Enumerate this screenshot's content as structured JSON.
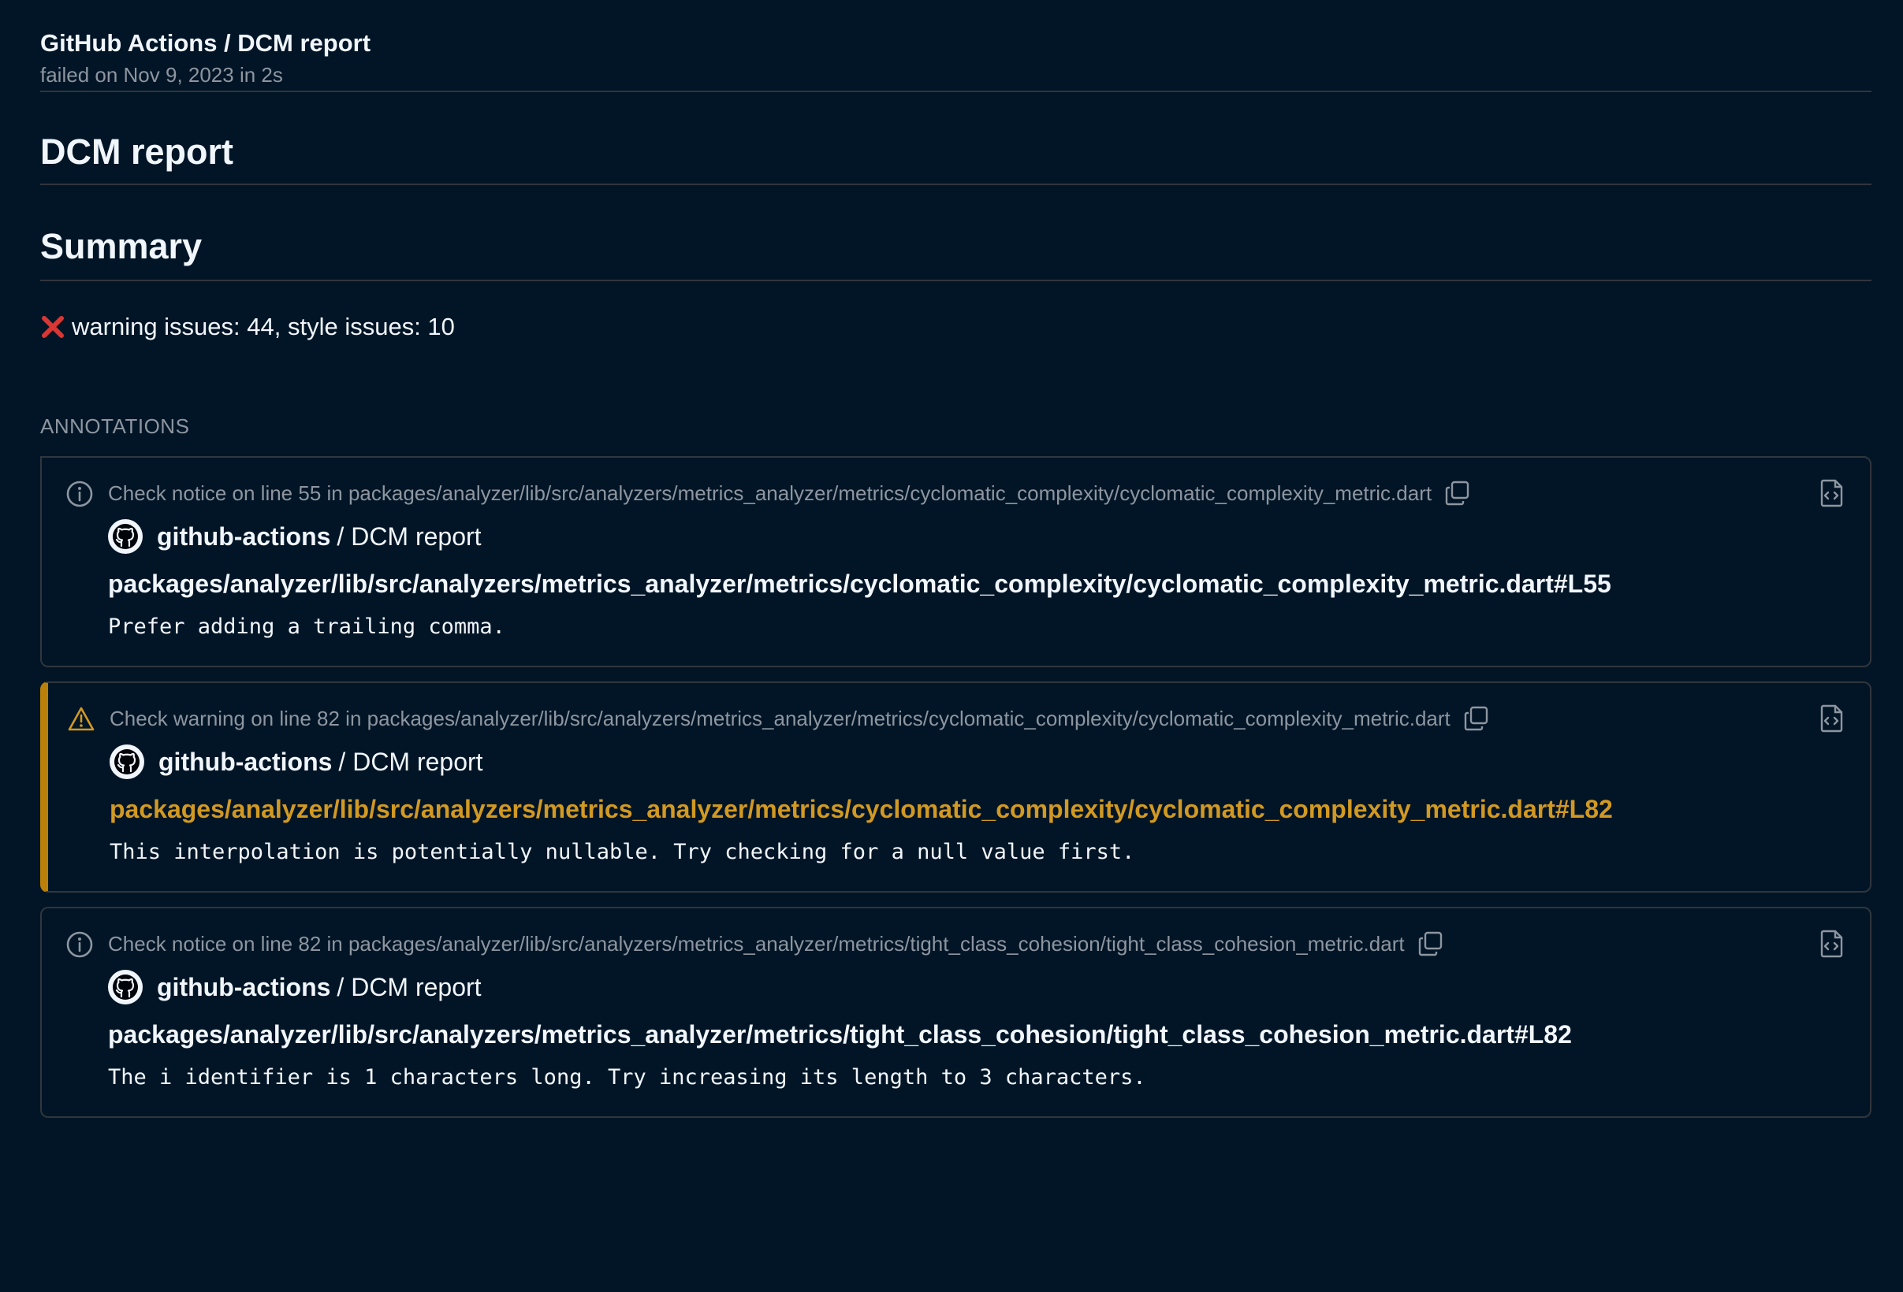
{
  "header": {
    "title": "GitHub Actions / DCM report",
    "subtitle": "failed on Nov 9, 2023 in 2s"
  },
  "report": {
    "title": "DCM report",
    "summary_heading": "Summary",
    "summary_text": "warning issues: 44, style issues: 10"
  },
  "annotations_label": "ANNOTATIONS",
  "annotations": [
    {
      "level": "notice",
      "head": "Check notice on line 55 in packages/analyzer/lib/src/analyzers/metrics_analyzer/metrics/cyclomatic_complexity/cyclomatic_complexity_metric.dart",
      "author": "github-actions",
      "author_rest": "/ DCM report",
      "path": "packages/analyzer/lib/src/analyzers/metrics_analyzer/metrics/cyclomatic_complexity/cyclomatic_complexity_metric.dart#L55",
      "message": "Prefer adding a trailing comma."
    },
    {
      "level": "warning",
      "head": "Check warning on line 82 in packages/analyzer/lib/src/analyzers/metrics_analyzer/metrics/cyclomatic_complexity/cyclomatic_complexity_metric.dart",
      "author": "github-actions",
      "author_rest": "/ DCM report",
      "path": "packages/analyzer/lib/src/analyzers/metrics_analyzer/metrics/cyclomatic_complexity/cyclomatic_complexity_metric.dart#L82",
      "message": "This interpolation is potentially nullable. Try checking for a null value first."
    },
    {
      "level": "notice",
      "head": "Check notice on line 82 in packages/analyzer/lib/src/analyzers/metrics_analyzer/metrics/tight_class_cohesion/tight_class_cohesion_metric.dart",
      "author": "github-actions",
      "author_rest": "/ DCM report",
      "path": "packages/analyzer/lib/src/analyzers/metrics_analyzer/metrics/tight_class_cohesion/tight_class_cohesion_metric.dart#L82",
      "message": "The i identifier is 1 characters long. Try increasing its length to 3 characters."
    }
  ],
  "icons": {
    "notice": "info-icon",
    "warning": "alert-icon",
    "copy": "copy-icon",
    "file": "file-code-icon",
    "avatar": "github-mark-icon",
    "fail": "x-mark-icon"
  },
  "colors": {
    "background": "#021526",
    "warning_accent": "#bb8009",
    "warning_text": "#d29922",
    "fail_red": "#da3633",
    "muted": "#8d96a0"
  }
}
